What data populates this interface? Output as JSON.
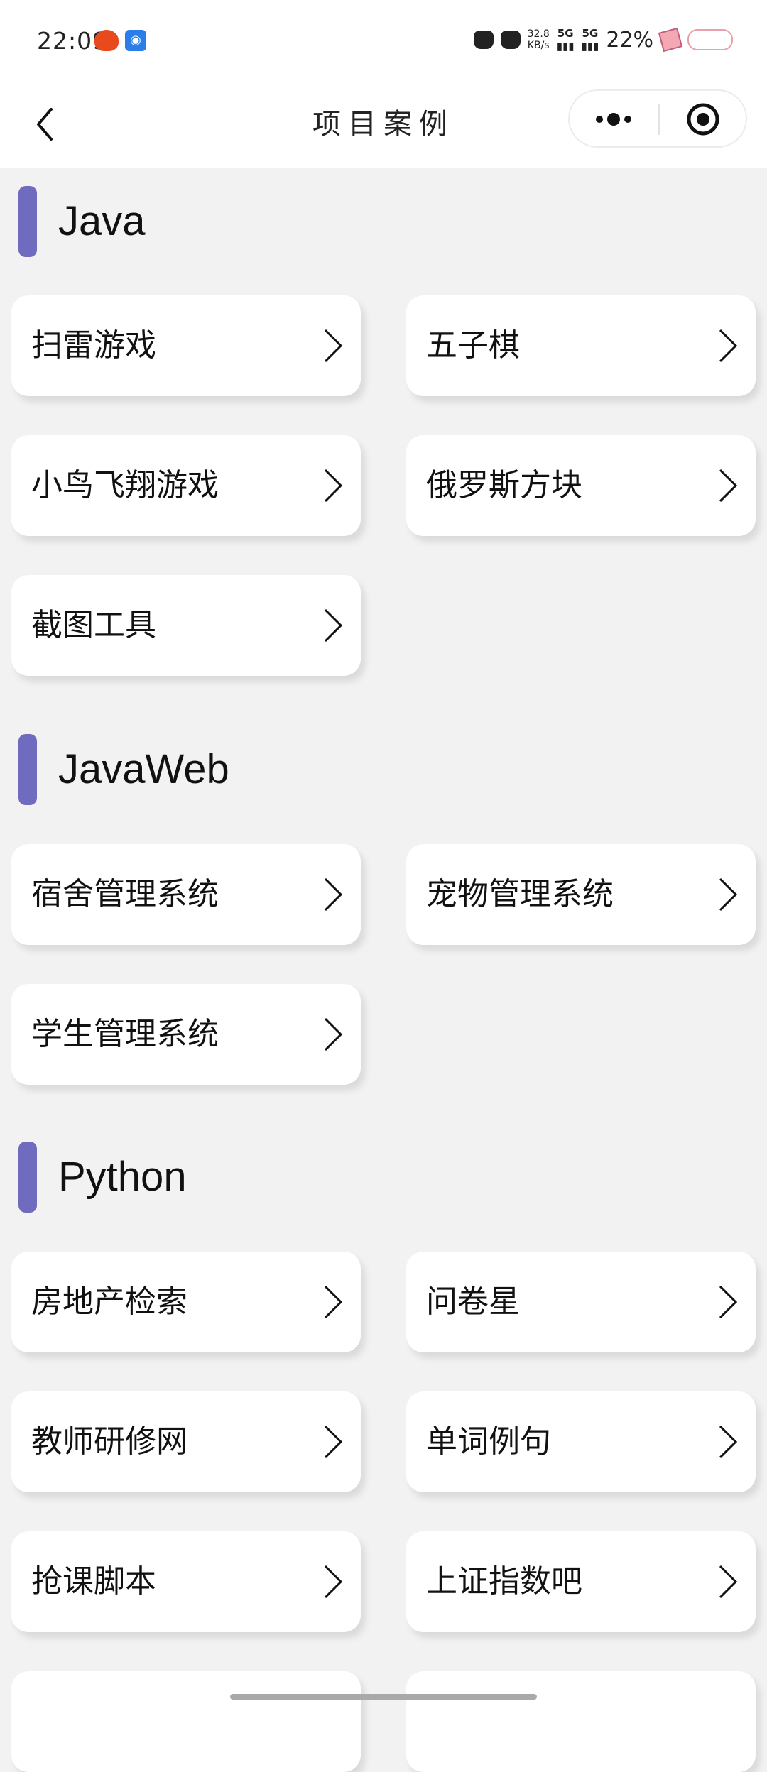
{
  "status_bar": {
    "time": "22:09",
    "net_speed_value": "32.8",
    "net_speed_unit": "KB/s",
    "signal_1": "5G",
    "signal_2": "5G",
    "battery": "22%"
  },
  "nav": {
    "title": "项目案例"
  },
  "sections": [
    {
      "title": "Java",
      "items": [
        "扫雷游戏",
        "五子棋",
        "小鸟飞翔游戏",
        "俄罗斯方块",
        "截图工具"
      ]
    },
    {
      "title": "JavaWeb",
      "items": [
        "宿舍管理系统",
        "宠物管理系统",
        "学生管理系统"
      ]
    },
    {
      "title": "Python",
      "items": [
        "房地产检索",
        "问卷星",
        "教师研修网",
        "单词例句",
        "抢课脚本",
        "上证指数吧"
      ]
    }
  ],
  "colors": {
    "accent": "#6f6cc0",
    "background": "#f2f2f2",
    "card": "#ffffff"
  },
  "icons": {
    "back": "chevron-left-icon",
    "more": "more-dots-icon",
    "close": "target-close-icon",
    "card_arrow": "chevron-right-icon"
  }
}
